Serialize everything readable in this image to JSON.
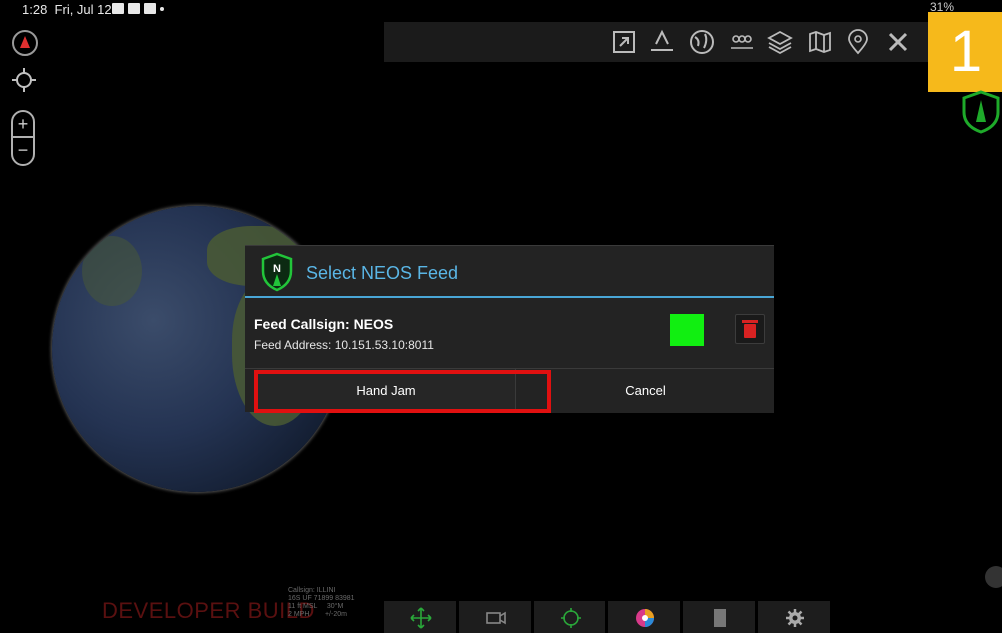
{
  "status_bar": {
    "time": "1:28",
    "date": "Fri, Jul 12",
    "battery": "31%"
  },
  "map_controls": {
    "zoom_in": "+",
    "zoom_out": "−"
  },
  "toolbar": {
    "icons": [
      "expand-icon",
      "elevation-icon",
      "globe-icon",
      "contacts-icon",
      "layers-icon",
      "map-icon",
      "add-marker-icon",
      "close-tools-icon"
    ]
  },
  "step_badge": "1",
  "dialog": {
    "title": "Select NEOS Feed",
    "feed_callsign": "Feed Callsign: NEOS",
    "feed_address": "Feed Address: 10.151.53.10:8011",
    "status_color": "#11ef11",
    "hand_jam_label": "Hand Jam",
    "cancel_label": "Cancel"
  },
  "overlay": {
    "developer_build": "DEVELOPER BUILD",
    "self_info": "Callsign: ILLINI\n16S UF 71899 83981\n11 ft MSL     30°M\n2 MPH        +/-20m"
  },
  "colors": {
    "accent": "#49a6d6",
    "highlight": "#e01010",
    "badge": "#f6b91b"
  }
}
